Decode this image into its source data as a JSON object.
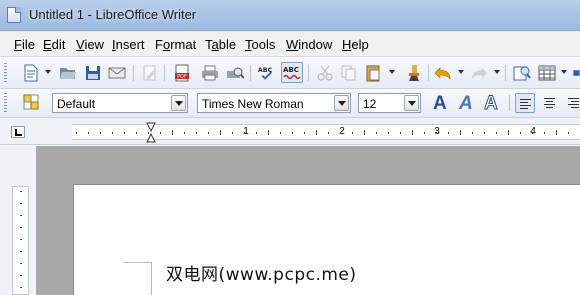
{
  "window": {
    "title": "Untitled 1 - LibreOffice Writer"
  },
  "menu": [
    {
      "pre": "",
      "key": "F",
      "post": "ile"
    },
    {
      "pre": "",
      "key": "E",
      "post": "dit"
    },
    {
      "pre": "",
      "key": "V",
      "post": "iew"
    },
    {
      "pre": "",
      "key": "I",
      "post": "nsert"
    },
    {
      "pre": "F",
      "key": "o",
      "post": "rmat"
    },
    {
      "pre": "T",
      "key": "a",
      "post": "ble"
    },
    {
      "pre": "",
      "key": "T",
      "post": "ools"
    },
    {
      "pre": "",
      "key": "W",
      "post": "indow"
    },
    {
      "pre": "",
      "key": "H",
      "post": "elp"
    }
  ],
  "toolbar": {
    "icons": [
      "new-document",
      "open",
      "save",
      "email",
      "edit-file",
      "export-pdf",
      "print",
      "print-preview",
      "spellcheck",
      "autospellcheck",
      "cut",
      "copy",
      "paste",
      "clone-formatting",
      "undo",
      "redo",
      "navigator",
      "table",
      "more"
    ]
  },
  "formatting": {
    "style": "Default",
    "font": "Times New Roman",
    "size": "12"
  },
  "ruler": {
    "labels": [
      "1",
      "2",
      "3",
      "4"
    ]
  },
  "document": {
    "watermark": "双电网(www.pcpc.me)"
  },
  "colors": {
    "titlebar": "#a9c4e3",
    "accent": "#1f5fbf",
    "document_bg": "#a9a9a9"
  }
}
